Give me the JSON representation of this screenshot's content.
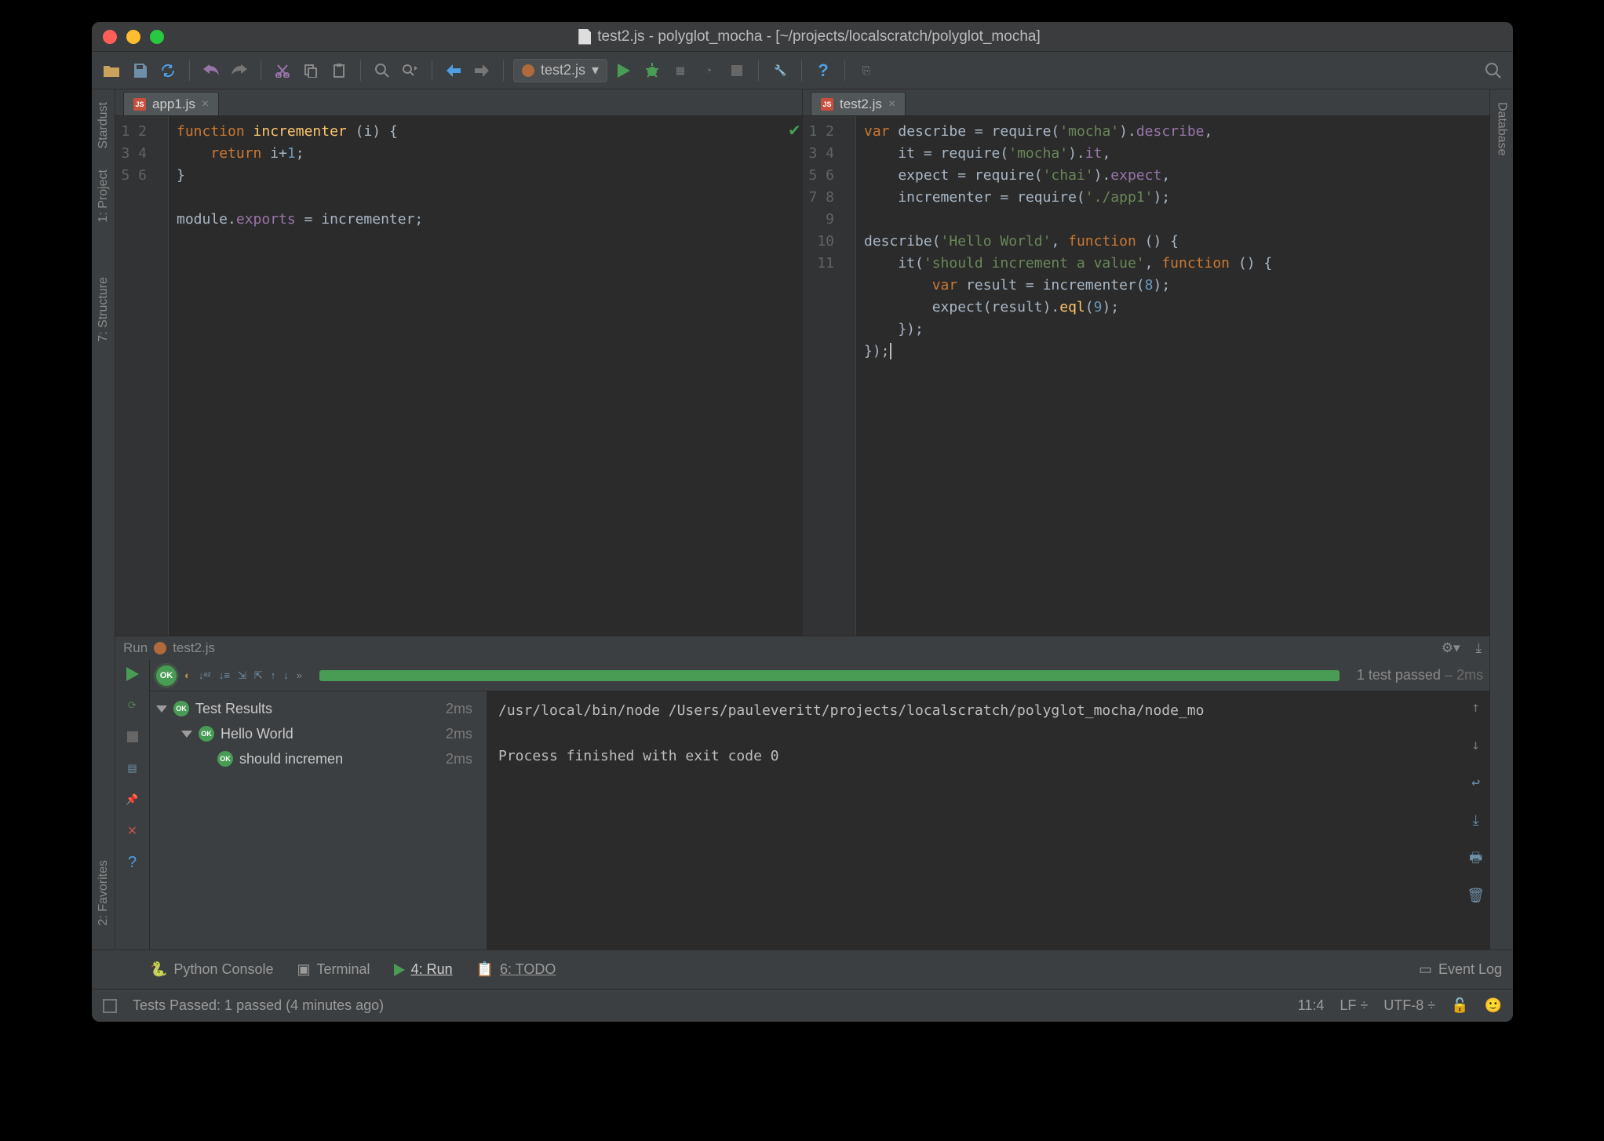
{
  "window": {
    "title": "test2.js - polyglot_mocha - [~/projects/localscratch/polyglot_mocha]"
  },
  "toolbar": {
    "run_config": "test2.js"
  },
  "leftTools": {
    "items": [
      "Stardust",
      "1: Project",
      "7: Structure",
      "2: Favorites"
    ]
  },
  "rightTools": {
    "items": [
      "Database"
    ]
  },
  "editorLeft": {
    "tab": "app1.js",
    "lines": [
      "1",
      "2",
      "3",
      "4",
      "5",
      "6"
    ]
  },
  "editorRight": {
    "tab": "test2.js",
    "lines": [
      "1",
      "2",
      "3",
      "4",
      "5",
      "6",
      "7",
      "8",
      "9",
      "10",
      "11"
    ]
  },
  "run": {
    "label": "Run",
    "target": "test2.js",
    "summary_tests": "1 test passed",
    "summary_time": "2ms",
    "tree": {
      "root": "Test Results",
      "root_time": "2ms",
      "suite": "Hello World",
      "suite_time": "2ms",
      "case": "should incremen",
      "case_time": "2ms"
    },
    "console_line1": "/usr/local/bin/node /Users/pauleveritt/projects/localscratch/polyglot_mocha/node_mo",
    "console_line2": "Process finished with exit code 0"
  },
  "bottomTabs": {
    "python": "Python Console",
    "terminal": "Terminal",
    "run": "4: Run",
    "todo": "6: TODO",
    "eventlog": "Event Log"
  },
  "status": {
    "msg": "Tests Passed: 1 passed (4 minutes ago)",
    "pos": "11:4",
    "sep": "LF",
    "enc": "UTF-8"
  }
}
